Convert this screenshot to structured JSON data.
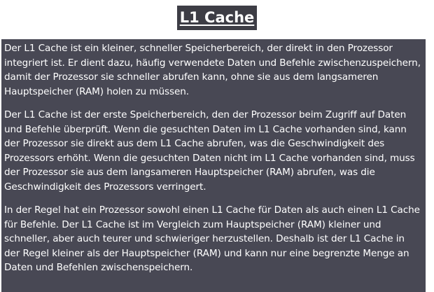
{
  "document": {
    "title": "L1 Cache",
    "paragraphs": [
      "Der L1 Cache ist ein kleiner, schneller Speicherbereich, der direkt in den Prozessor integriert ist. Er dient dazu, häufig verwendete Daten und Befehle zwischenzuspeichern, damit der Prozessor sie schneller abrufen kann, ohne sie aus dem langsameren Hauptspeicher (RAM) holen zu müssen.",
      "Der L1 Cache ist der erste Speicherbereich, den der Prozessor beim Zugriff auf Daten und Befehle überprüft. Wenn die gesuchten Daten im L1 Cache vorhanden sind, kann der Prozessor sie direkt aus dem L1 Cache abrufen, was die Geschwindigkeit des Prozessors erhöht. Wenn die gesuchten Daten nicht im L1 Cache vorhanden sind, muss der Prozessor sie aus dem langsameren Hauptspeicher (RAM) abrufen, was die Geschwindigkeit des Prozessors verringert.",
      "In der Regel hat ein Prozessor sowohl einen L1 Cache für Daten als auch einen L1 Cache für Befehle. Der L1 Cache ist im Vergleich zum Hauptspeicher (RAM) kleiner und schneller, aber auch teurer und schwieriger herzustellen. Deshalb ist der L1 Cache in der Regel kleiner als der Hauptspeicher (RAM) und kann nur eine begrenzte Menge an Daten und Befehlen zwischenspeichern."
    ]
  },
  "colors": {
    "title_background": "#3d3d45",
    "content_background": "#484854",
    "text": "#ffffff"
  }
}
